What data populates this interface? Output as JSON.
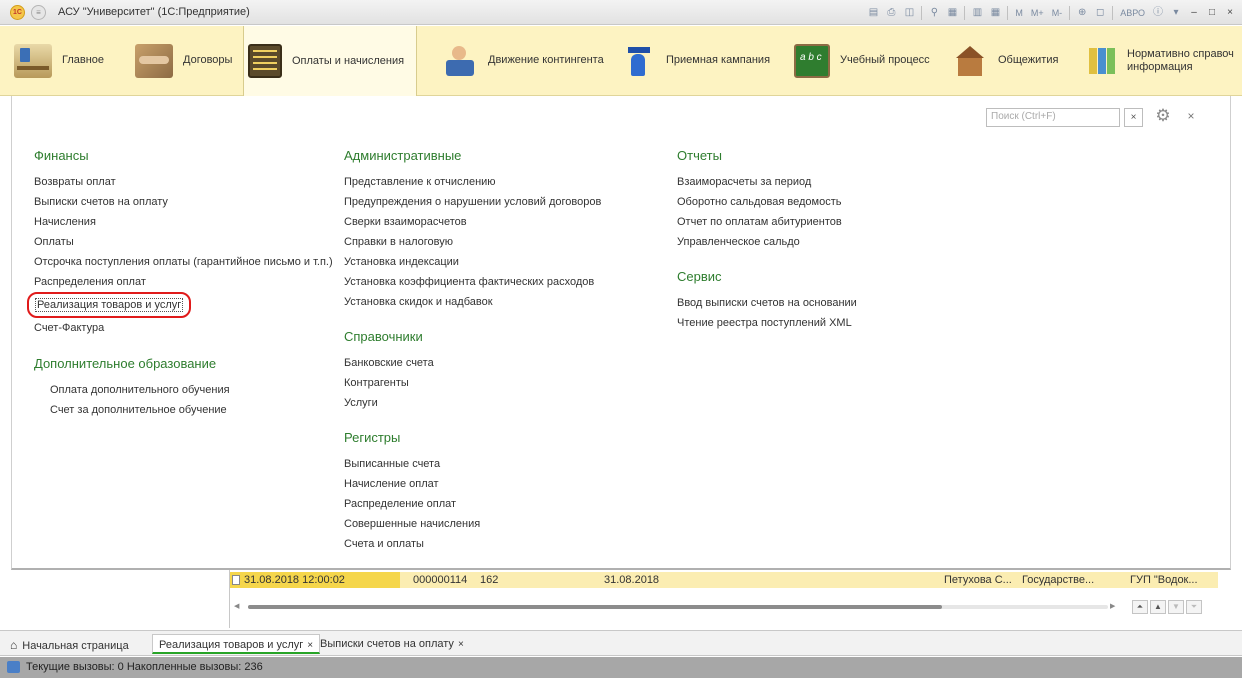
{
  "window": {
    "title": "АСУ \"Университет\" (1С:Предприятие)"
  },
  "titlebar_tools": [
    "M",
    "M+",
    "M-",
    "АВРО"
  ],
  "sections": [
    {
      "label": "Главное",
      "icon": "desk-icon"
    },
    {
      "label": "Договоры",
      "icon": "handshake-icon"
    },
    {
      "label": "Оплаты и начисления",
      "icon": "abacus-icon",
      "active": true
    },
    {
      "label": "Движение контингента",
      "icon": "person-computer-icon"
    },
    {
      "label": "Приемная кампания",
      "icon": "graduates-icon"
    },
    {
      "label": "Учебный процесс",
      "icon": "blackboard-icon"
    },
    {
      "label": "Общежития",
      "icon": "house-icon"
    },
    {
      "label1": "Нормативно справоч",
      "label2": "информация",
      "icon": "binders-icon"
    }
  ],
  "search": {
    "placeholder": "Поиск (Ctrl+F)",
    "clear": "×"
  },
  "columns": {
    "finance": {
      "title": "Финансы",
      "items": [
        "Возвраты оплат",
        "Выписки счетов на оплату",
        "Начисления",
        "Оплаты",
        "Отсрочка поступления оплаты (гарантийное письмо и т.п.)",
        "Распределения оплат",
        "Реализация товаров и услуг",
        "Счет-Фактура"
      ]
    },
    "extra_edu": {
      "title": "Дополнительное образование",
      "items": [
        "Оплата дополнительного обучения",
        "Счет за дополнительное обучение"
      ]
    },
    "admin": {
      "title": "Административные",
      "items": [
        "Представление к отчислению",
        "Предупреждения о нарушении условий договоров",
        "Сверки взаиморасчетов",
        "Справки в налоговую",
        "Установка индексации",
        "Установка коэффициента фактических расходов",
        "Установка скидок и надбавок"
      ]
    },
    "refs": {
      "title": "Справочники",
      "items": [
        "Банковские счета",
        "Контрагенты",
        "Услуги"
      ]
    },
    "registers": {
      "title": "Регистры",
      "items": [
        "Выписанные счета",
        "Начисление оплат",
        "Распределение оплат",
        "Совершенные начисления",
        "Счета и оплаты"
      ]
    },
    "reports": {
      "title": "Отчеты",
      "items": [
        "Взаиморасчеты за период",
        "Оборотно сальдовая ведомость",
        "Отчет по оплатам абитуриентов",
        "Управленческое сальдо"
      ]
    },
    "service": {
      "title": "Сервис",
      "items": [
        "Ввод выписки счетов на основании",
        "Чтение реестра поступлений XML"
      ]
    }
  },
  "table_row": {
    "date": "31.08.2018 12:00:02",
    "number": "000000114",
    "code": "162",
    "date2": "31.08.2018",
    "person": "Петухова С...",
    "type": "Государстве...",
    "org": "ГУП \"Водок..."
  },
  "tabs": [
    {
      "label": "Начальная страница"
    },
    {
      "label": "Реализация товаров и услуг",
      "active": true,
      "close": "×"
    },
    {
      "label": "Выписки счетов на оплату",
      "close": "×"
    }
  ],
  "status": {
    "text": "Текущие вызовы: 0   Накопленные вызовы: 236"
  }
}
